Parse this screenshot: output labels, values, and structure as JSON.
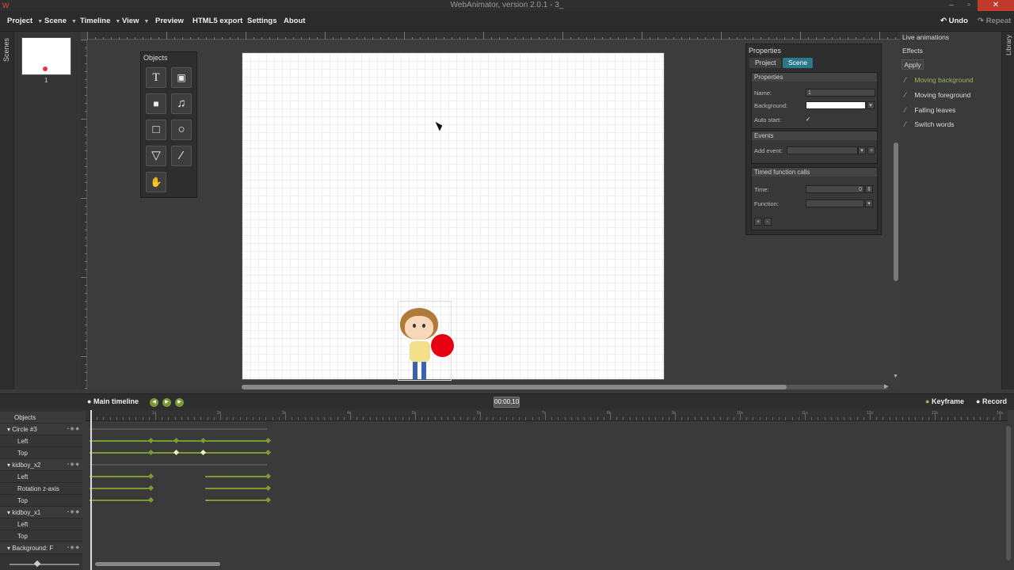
{
  "app": {
    "title": "WebAnimator, version 2.0.1 - 3_",
    "undo": "Undo",
    "repeat": "Repeat"
  },
  "menu": {
    "items": [
      {
        "label": "Project",
        "caret": true
      },
      {
        "label": "Scene",
        "caret": true
      },
      {
        "label": "Timeline",
        "caret": true
      },
      {
        "label": "View",
        "caret": true
      },
      {
        "label": "Preview",
        "caret": false
      },
      {
        "label": "HTML5 export",
        "caret": false
      },
      {
        "label": "Settings",
        "caret": false
      },
      {
        "label": "About",
        "caret": false
      }
    ]
  },
  "scenes": {
    "label": "Scenes",
    "thumb_number": "1"
  },
  "objects_panel": {
    "title": "Objects",
    "tools": [
      "text-tool",
      "image-tool",
      "video-tool",
      "audio-tool",
      "rectangle-tool",
      "circle-tool",
      "triangle-tool",
      "line-tool",
      "hand-tool"
    ]
  },
  "properties": {
    "title": "Properties",
    "tabs": [
      "Project",
      "Scene"
    ],
    "active_tab": "Scene",
    "section_properties": "Properties",
    "name_label": "Name:",
    "name_value": "1",
    "background_label": "Background:",
    "autostart_label": "Auto start:",
    "autostart_checked": "✓",
    "section_events": "Events",
    "add_event_label": "Add event:",
    "section_timed": "Timed function calls",
    "time_label": "Time:",
    "time_value": "0",
    "function_label": "Function:",
    "add_btn": "+",
    "remove_btn": "-"
  },
  "right_panel": {
    "live_animations": "Live animations",
    "effects": "Effects",
    "apply": "Apply",
    "effect_items": [
      {
        "label": "Moving background",
        "highlight": true
      },
      {
        "label": "Moving foreground",
        "highlight": false
      },
      {
        "label": "Falling leaves",
        "highlight": false
      },
      {
        "label": "Switch words",
        "highlight": false
      }
    ],
    "library": "Library"
  },
  "timeline": {
    "main_label": "Main timeline",
    "time": "00:00,10",
    "keyframe": "Keyframe",
    "record": "Record",
    "objects_header": "Objects",
    "rows": [
      {
        "label": "Circle #3",
        "type": "obj"
      },
      {
        "label": "Left",
        "type": "prop"
      },
      {
        "label": "Top",
        "type": "prop"
      },
      {
        "label": "kidboy_x2",
        "type": "obj"
      },
      {
        "label": "Left",
        "type": "prop"
      },
      {
        "label": "Rotation z-axis",
        "type": "prop"
      },
      {
        "label": "Top",
        "type": "prop"
      },
      {
        "label": "kidboy_x1",
        "type": "obj"
      },
      {
        "label": "Left",
        "type": "prop"
      },
      {
        "label": "Top",
        "type": "prop"
      },
      {
        "label": "Background: F",
        "type": "obj"
      }
    ],
    "ruler_labels": [
      "1s",
      "2s",
      "3s",
      "4s",
      "5s",
      "6s",
      "7s",
      "8s",
      "9s",
      "10s",
      "11s",
      "12s",
      "13s",
      "14s"
    ]
  },
  "colors": {
    "accent_green": "#7a9a36",
    "tab_active": "#2b7a8c",
    "ball_red": "#e60012"
  }
}
